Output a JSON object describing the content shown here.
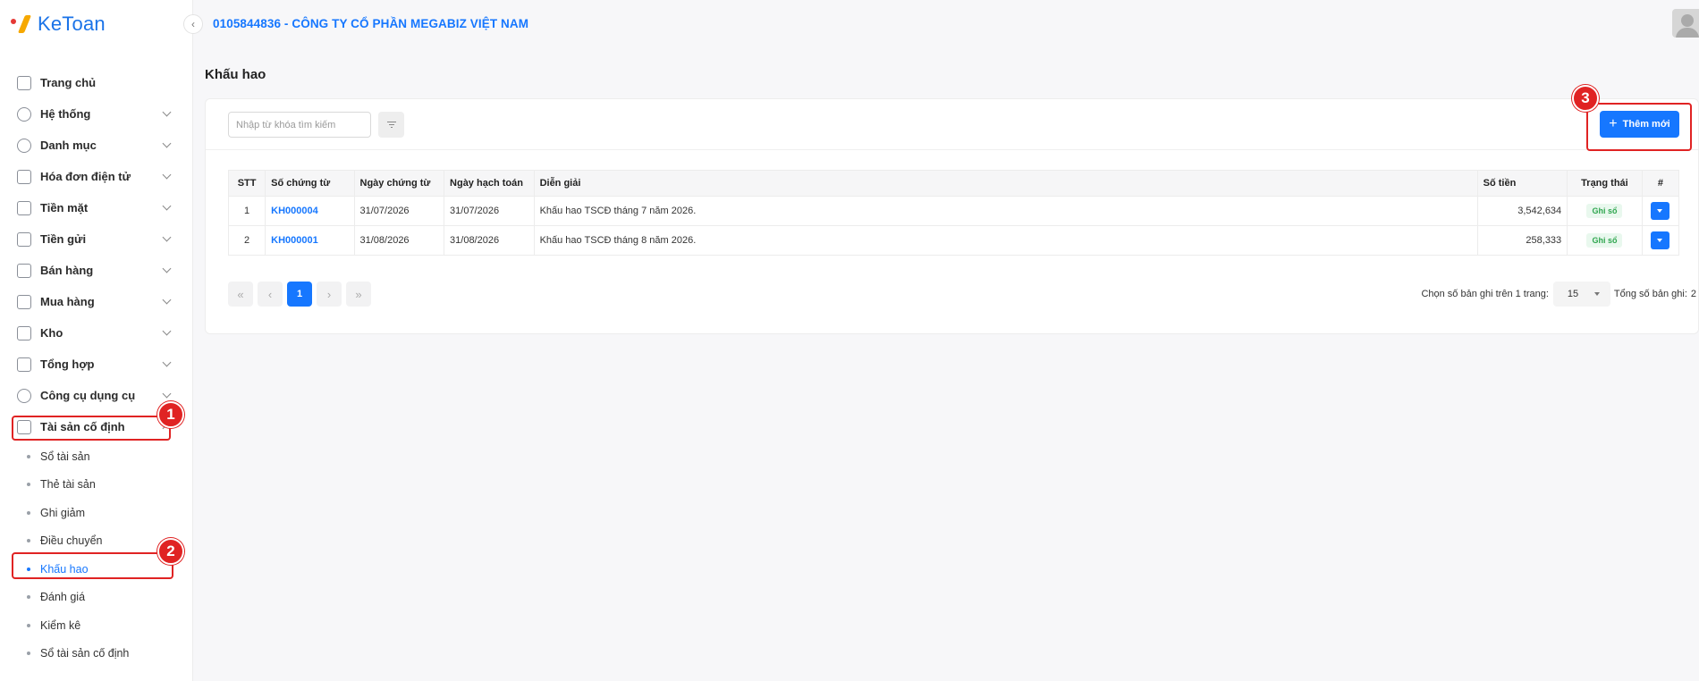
{
  "app": {
    "logo_text": "KeToan"
  },
  "header": {
    "company": "0105844836 - CÔNG TY CỔ PHẦN MEGABIZ VIỆT NAM"
  },
  "sidebar": {
    "items": [
      {
        "label": "Trang chủ"
      },
      {
        "label": "Hệ thống"
      },
      {
        "label": "Danh mục"
      },
      {
        "label": "Hóa đơn điện tử"
      },
      {
        "label": "Tiền mặt"
      },
      {
        "label": "Tiền gửi"
      },
      {
        "label": "Bán hàng"
      },
      {
        "label": "Mua hàng"
      },
      {
        "label": "Kho"
      },
      {
        "label": "Tổng hợp"
      },
      {
        "label": "Công cụ dụng cụ"
      },
      {
        "label": "Tài sản cố định"
      }
    ],
    "sub_items": [
      {
        "label": "Sổ tài sản"
      },
      {
        "label": "Thẻ tài sản"
      },
      {
        "label": "Ghi giảm"
      },
      {
        "label": "Điều chuyển"
      },
      {
        "label": "Khấu hao"
      },
      {
        "label": "Đánh giá"
      },
      {
        "label": "Kiểm kê"
      },
      {
        "label": "Sổ tài sản cố định"
      }
    ]
  },
  "page": {
    "title": "Khấu hao"
  },
  "search": {
    "placeholder": "Nhập từ khóa tìm kiếm",
    "value": ""
  },
  "toolbar": {
    "add_label": "Thêm mới"
  },
  "table": {
    "headers": {
      "stt": "STT",
      "doc_no": "Số chứng từ",
      "doc_date": "Ngày chứng từ",
      "post_date": "Ngày hạch toán",
      "description": "Diễn giải",
      "amount": "Số tiền",
      "status": "Trạng thái",
      "action": "#"
    },
    "rows": [
      {
        "stt": "1",
        "doc_no": "KH000004",
        "doc_date": "31/07/2026",
        "post_date": "31/07/2026",
        "description": "Khấu hao TSCĐ tháng 7 năm 2026.",
        "amount": "3,542,634",
        "status": "Ghi sổ"
      },
      {
        "stt": "2",
        "doc_no": "KH000001",
        "doc_date": "31/08/2026",
        "post_date": "31/08/2026",
        "description": "Khấu hao TSCĐ tháng 8 năm 2026.",
        "amount": "258,333",
        "status": "Ghi sổ"
      }
    ]
  },
  "pagination": {
    "current_page": "1",
    "page_size_label": "Chọn số bản ghi trên 1 trang:",
    "page_size": "15",
    "total_label": "Tổng số bản ghi:",
    "total": "2"
  },
  "annotations": {
    "one": "1",
    "two": "2",
    "three": "3"
  },
  "colors": {
    "primary": "#1677ff",
    "annotation": "#e02323",
    "success_bg": "#e9f8ee",
    "success_text": "#2fa64f"
  }
}
